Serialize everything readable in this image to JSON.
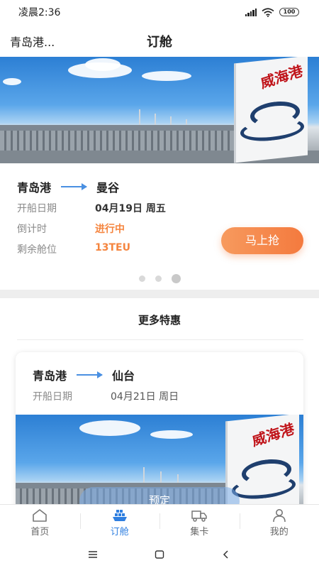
{
  "status_bar": {
    "time": "凌晨2:36",
    "battery": "100"
  },
  "header": {
    "location": "青岛港...",
    "title": "订舱"
  },
  "featured": {
    "origin": "青岛港",
    "destination": "曼谷",
    "rows": [
      {
        "label": "开船日期",
        "value": "04月19日 周五"
      },
      {
        "label": "倒计时",
        "value": "进行中"
      },
      {
        "label": "剩余舱位",
        "value": "13TEU"
      }
    ],
    "action_label": "马上抢",
    "carousel": {
      "total": 3,
      "active": 3
    }
  },
  "more_deals": {
    "title": "更多特惠",
    "items": [
      {
        "origin": "青岛港",
        "destination": "仙台",
        "date_label": "开船日期",
        "date_value": "04月21日 周日",
        "book_label": "预定"
      }
    ]
  },
  "banner": {
    "monument_text": "威海港"
  },
  "tabs": [
    {
      "label": "首页",
      "icon": "home-icon",
      "active": false
    },
    {
      "label": "订舱",
      "icon": "ship-icon",
      "active": true
    },
    {
      "label": "集卡",
      "icon": "truck-icon",
      "active": false
    },
    {
      "label": "我的",
      "icon": "user-icon",
      "active": false
    }
  ],
  "colors": {
    "accent": "#2f7fe0",
    "orange": "#f47a3e",
    "arrow": "#4a90e2"
  }
}
